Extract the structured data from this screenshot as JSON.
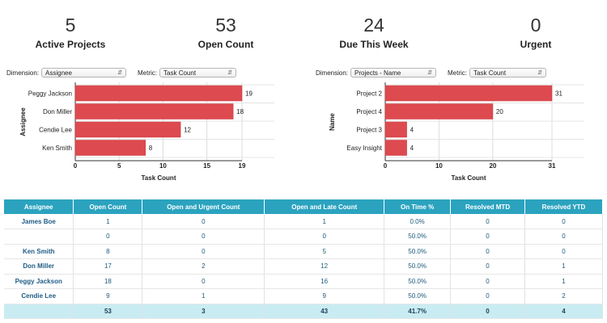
{
  "kpis": [
    {
      "value": "5",
      "label": "Active Projects"
    },
    {
      "value": "53",
      "label": "Open Count"
    },
    {
      "value": "24",
      "label": "Due This Week"
    },
    {
      "value": "0",
      "label": "Urgent"
    }
  ],
  "left_controls": {
    "dimension_label": "Dimension:",
    "dimension_value": "Assignee",
    "metric_label": "Metric:",
    "metric_value": "Task Count"
  },
  "right_controls": {
    "dimension_label": "Dimension:",
    "dimension_value": "Projects - Name",
    "metric_label": "Metric:",
    "metric_value": "Task Count"
  },
  "colors": {
    "bar": "#dd4a4f",
    "header": "#2ba3bf",
    "total_row": "#c9ecf3"
  },
  "chart_data": [
    {
      "type": "bar",
      "orientation": "horizontal",
      "categories": [
        "Peggy Jackson",
        "Don Miller",
        "Cendie Lee",
        "Ken Smith"
      ],
      "values": [
        19,
        18,
        12,
        8
      ],
      "xlabel": "Task Count",
      "ylabel": "Assignee",
      "ticks": [
        "0",
        "5",
        "10",
        "15",
        "19"
      ],
      "xlim": [
        0,
        19
      ],
      "grid": true
    },
    {
      "type": "bar",
      "orientation": "horizontal",
      "categories": [
        "Project 2",
        "Project 4",
        "Project 3",
        "Easy Insight"
      ],
      "values": [
        31,
        20,
        4,
        4
      ],
      "xlabel": "Task Count",
      "ylabel": "Name",
      "ticks": [
        "0",
        "10",
        "20",
        "31"
      ],
      "xlim": [
        0,
        31
      ],
      "grid": true
    }
  ],
  "table": {
    "headers": [
      "Assignee",
      "Open Count",
      "Open and Urgent Count",
      "Open and Late Count",
      "On Time %",
      "Resolved MTD",
      "Resolved YTD"
    ],
    "rows": [
      [
        "James Boe",
        "1",
        "0",
        "1",
        "0.0%",
        "0",
        "0"
      ],
      [
        "",
        "0",
        "0",
        "0",
        "50.0%",
        "0",
        "0"
      ],
      [
        "Ken Smith",
        "8",
        "0",
        "5",
        "50.0%",
        "0",
        "0"
      ],
      [
        "Don Miller",
        "17",
        "2",
        "12",
        "50.0%",
        "0",
        "1"
      ],
      [
        "Peggy Jackson",
        "18",
        "0",
        "16",
        "50.0%",
        "0",
        "1"
      ],
      [
        "Cendie Lee",
        "9",
        "1",
        "9",
        "50.0%",
        "0",
        "2"
      ]
    ],
    "total": [
      "",
      "53",
      "3",
      "43",
      "41.7%",
      "0",
      "4"
    ]
  }
}
